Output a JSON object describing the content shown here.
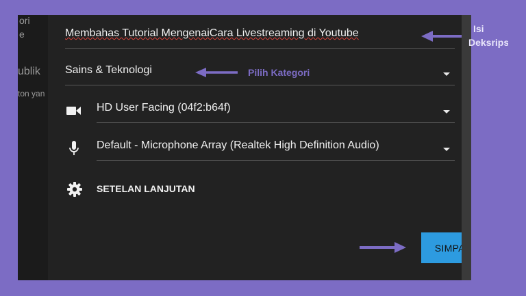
{
  "left_panel": {
    "fragments": [
      "ori",
      "e",
      "ublik",
      "ton yan"
    ]
  },
  "dialog": {
    "description_value": "Membahas Tutorial MengenaiCara Livestreaming di Youtube",
    "category_value": "Sains & Teknologi",
    "camera_value": "HD User Facing (04f2:b64f)",
    "microphone_value": "Default - Microphone Array (Realtek High Definition Audio)",
    "advanced_label": "SETELAN LANJUTAN",
    "save_label": "SIMPAN"
  },
  "annotations": {
    "description_note_line1": "Isi",
    "description_note_line2": "Deksripsi",
    "category_note": "Pilih Kategori"
  },
  "icons": {
    "camera": "videocam-icon",
    "microphone": "mic-icon",
    "settings": "gear-icon",
    "dropdown": "triangle-down-icon",
    "pointer": "arrow-left-icon",
    "pointer_right": "arrow-right-icon"
  },
  "colors": {
    "frame": "#7c6cc4",
    "dialog_bg": "#222222",
    "button": "#2d9be0",
    "annotation": "#7c6cc4"
  }
}
